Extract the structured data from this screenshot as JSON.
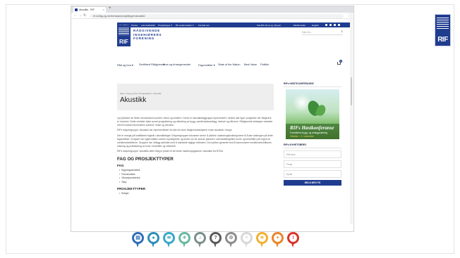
{
  "browser": {
    "tab_title": "Akustikk - RIF",
    "tab_close": "×",
    "new_tab": "+",
    "back": "←",
    "forward": "→",
    "reload": "↻",
    "url": "rif.no/fag-og-merkerskap/prosjekttyper/akustikk/",
    "menu": "⋮"
  },
  "side_logo": {
    "letters": "RIF",
    "small": "RÅDGIVENDE INGENIØRERS FORENING"
  },
  "site": {
    "topbar_left": [
      "Om RIF ▾",
      "Presse",
      "Lønnsstatistikk",
      "Prosjekttyper ▾",
      "Bli medlem/søker ▾",
      "Kontakt oss"
    ],
    "topbar_right": [
      "Søk RIF-firma og -tilsyner",
      "Medlemsider",
      "English"
    ],
    "logo_letters": "RIF",
    "logo_text": [
      "RÅDGIVENDE",
      "INGENIØRERS",
      "FORENING"
    ],
    "search_placeholder": "Søk her...",
    "search_icon": "⌕",
    "nav": [
      "Råd og fora ▾",
      "Sertifisert Rådgivende",
      "Kurs og Arrangementer",
      "Fagområder ▾",
      "State of the Nation",
      "Best Value",
      "Politikk"
    ],
    "cart_count": "0"
  },
  "page": {
    "breadcrumb": "Hjem  /  Fag og fora  /  Prosjekttyper  /  Akustikk",
    "title": "Akustikk",
    "paragraphs": [
      "Lyd påvirker de fleste menneskers komfort, helse og velvære. Derfor er akustikkfaggruppa representert i nesten alle typer prosjekter der rådgivere er involvert. Dette omfatter blant annet prosjektering og utbedring av bygg, samferdselsanlegg, industri og offshore. Rådgivende selskaper arbeider med å ivareta menneskers komfort, helse og velvære.",
      "RIFs ekspertgruppe i akustikk har representanter fra alle de store rådgiverselskapene innen akustikk i Norge.",
      "Det er mange på kvalifiserte fagfolk i akustikkfaget. Ekspertgruppen fokuserer derfor å påvirke utdanningsinstitusjonene til å øke satsingen på dette fagområdet. Gruppen har også initiativ overfor myndigheter og andre om for ansvar plassert i rammebetingelser (lover og forskrifter) på vegne av medlemsbedriftene. Gruppen har i tillegg arbeidet med å utarbeide faglige veiledere. Den jobber generelt med å harmonisere medlemsbedriftenes tolkning og praktisering av lover, forskrifter og veiledere.",
      "RIFs ekspertgruppe i akustikk deler årlig ut prisen til de beste masteroppgavene i akustikk fra NTNU."
    ],
    "h_fag_og_prosjekttyper": "FAG OG PROSJEKTTYPER",
    "h_fag": "FAG",
    "fag_items": [
      "Bygningsakustikk",
      "Romakustikk",
      "Vibrasjonsteknikk",
      "Støy"
    ],
    "h_prosjekttyper": "PROSJEKTTYPER",
    "prosjekt_items": [
      "Boliger"
    ]
  },
  "sidebar": {
    "conference_heading": "RIFs HØSTKONFERANSE",
    "banner_title": "RIFs Høstkonferanse",
    "banner_sub": "Framtidens bygg- og anleggsnæring",
    "banner_date": "Oktober – 3. november",
    "newsletter_heading": "RIFs NYHETSBREV",
    "fields": [
      "Ditt navn",
      "Firma",
      "Epost"
    ],
    "submit": "MELD MEG PÅ"
  },
  "icons": [
    {
      "name": "document-pin-icon",
      "color": "#2f6fb5",
      "glyph": "▤"
    },
    {
      "name": "location-pin-icon",
      "color": "#2f8fb8",
      "glyph": "●"
    },
    {
      "name": "water-pin-icon",
      "color": "#38a8c8",
      "glyph": "≋"
    },
    {
      "name": "airplane-pin-icon",
      "color": "#68b8a0",
      "glyph": "✈"
    },
    {
      "name": "bell-pin-icon",
      "color": "#7a8f8a",
      "glyph": "♪"
    },
    {
      "name": "question-pin-icon",
      "color": "#5c5c5c",
      "glyph": "?"
    },
    {
      "name": "settings-pin-icon",
      "color": "#8c8c8c",
      "glyph": "⚙"
    },
    {
      "name": "lightbulb-pin-icon",
      "color": "#d8d8d8",
      "glyph": "✧"
    },
    {
      "name": "light-pin-icon",
      "color": "#f0b132",
      "glyph": "☀"
    },
    {
      "name": "plus-pin-icon",
      "color": "#e9862a",
      "glyph": "+"
    },
    {
      "name": "alert-pin-icon",
      "color": "#d9342b",
      "glyph": "!"
    }
  ]
}
